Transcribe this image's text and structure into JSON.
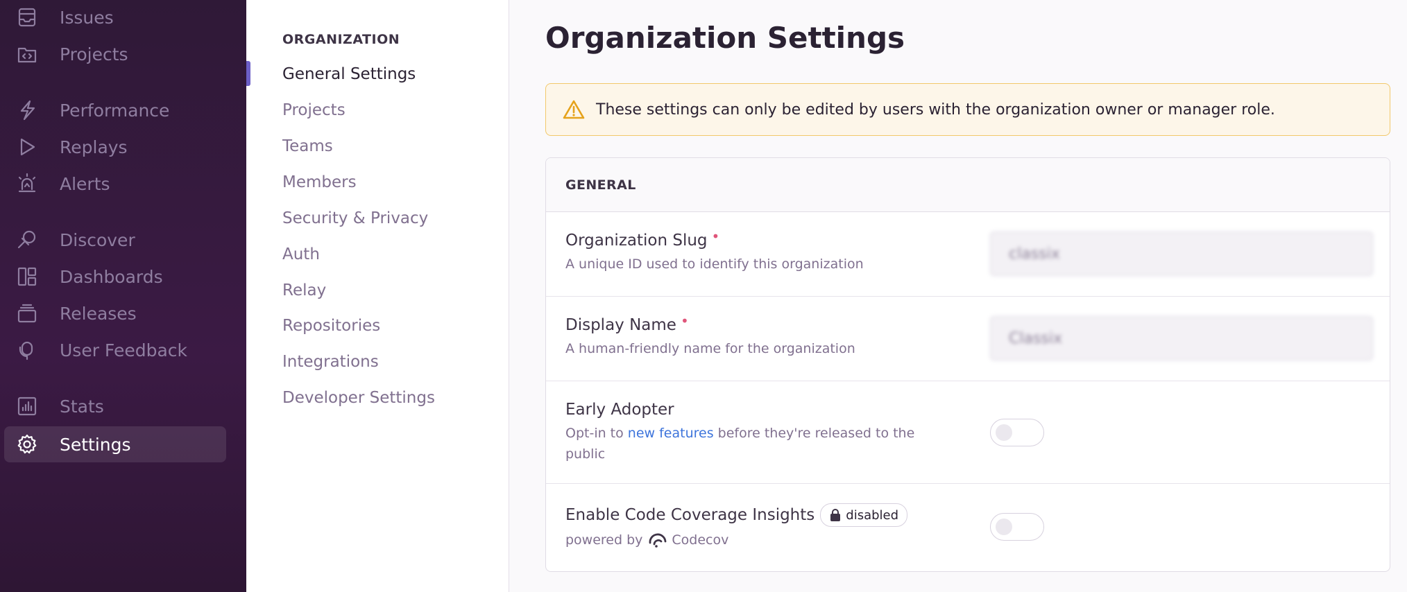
{
  "sidebar": {
    "items": [
      {
        "label": "Issues",
        "icon": "issues-icon"
      },
      {
        "label": "Projects",
        "icon": "projects-icon"
      },
      {
        "label": "Performance",
        "icon": "performance-icon"
      },
      {
        "label": "Replays",
        "icon": "replays-icon"
      },
      {
        "label": "Alerts",
        "icon": "alerts-icon"
      },
      {
        "label": "Discover",
        "icon": "discover-icon"
      },
      {
        "label": "Dashboards",
        "icon": "dashboards-icon"
      },
      {
        "label": "Releases",
        "icon": "releases-icon"
      },
      {
        "label": "User Feedback",
        "icon": "user-feedback-icon"
      },
      {
        "label": "Stats",
        "icon": "stats-icon"
      },
      {
        "label": "Settings",
        "icon": "gear-icon",
        "active": true
      }
    ]
  },
  "settings_nav": {
    "heading": "ORGANIZATION",
    "items": [
      {
        "label": "General Settings",
        "active": true
      },
      {
        "label": "Projects"
      },
      {
        "label": "Teams"
      },
      {
        "label": "Members"
      },
      {
        "label": "Security & Privacy"
      },
      {
        "label": "Auth"
      },
      {
        "label": "Relay"
      },
      {
        "label": "Repositories"
      },
      {
        "label": "Integrations"
      },
      {
        "label": "Developer Settings"
      }
    ]
  },
  "main": {
    "title": "Organization Settings",
    "alert": "These settings can only be edited by users with the organization owner or manager role.",
    "panel_title": "GENERAL",
    "fields": {
      "slug": {
        "label": "Organization Slug",
        "required": "•",
        "help": "A unique ID used to identify this organization",
        "value": "classix"
      },
      "display_name": {
        "label": "Display Name",
        "required": "•",
        "help": "A human-friendly name for the organization",
        "value": "Classix"
      },
      "early_adopter": {
        "label": "Early Adopter",
        "help_prefix": "Opt-in to ",
        "help_link": "new features",
        "help_suffix": " before they're released to the public",
        "enabled": false
      },
      "code_coverage": {
        "label": "Enable Code Coverage Insights",
        "badge": "disabled",
        "powered_by": "powered by",
        "provider": "Codecov",
        "enabled": false
      }
    }
  },
  "colors": {
    "sidebar_bg": "#2f1937",
    "accent": "#6c5fc7",
    "link": "#3d74db",
    "warning_bg": "#fdf6e9",
    "warning_border": "#f2c86a",
    "required": "#e0557a"
  }
}
